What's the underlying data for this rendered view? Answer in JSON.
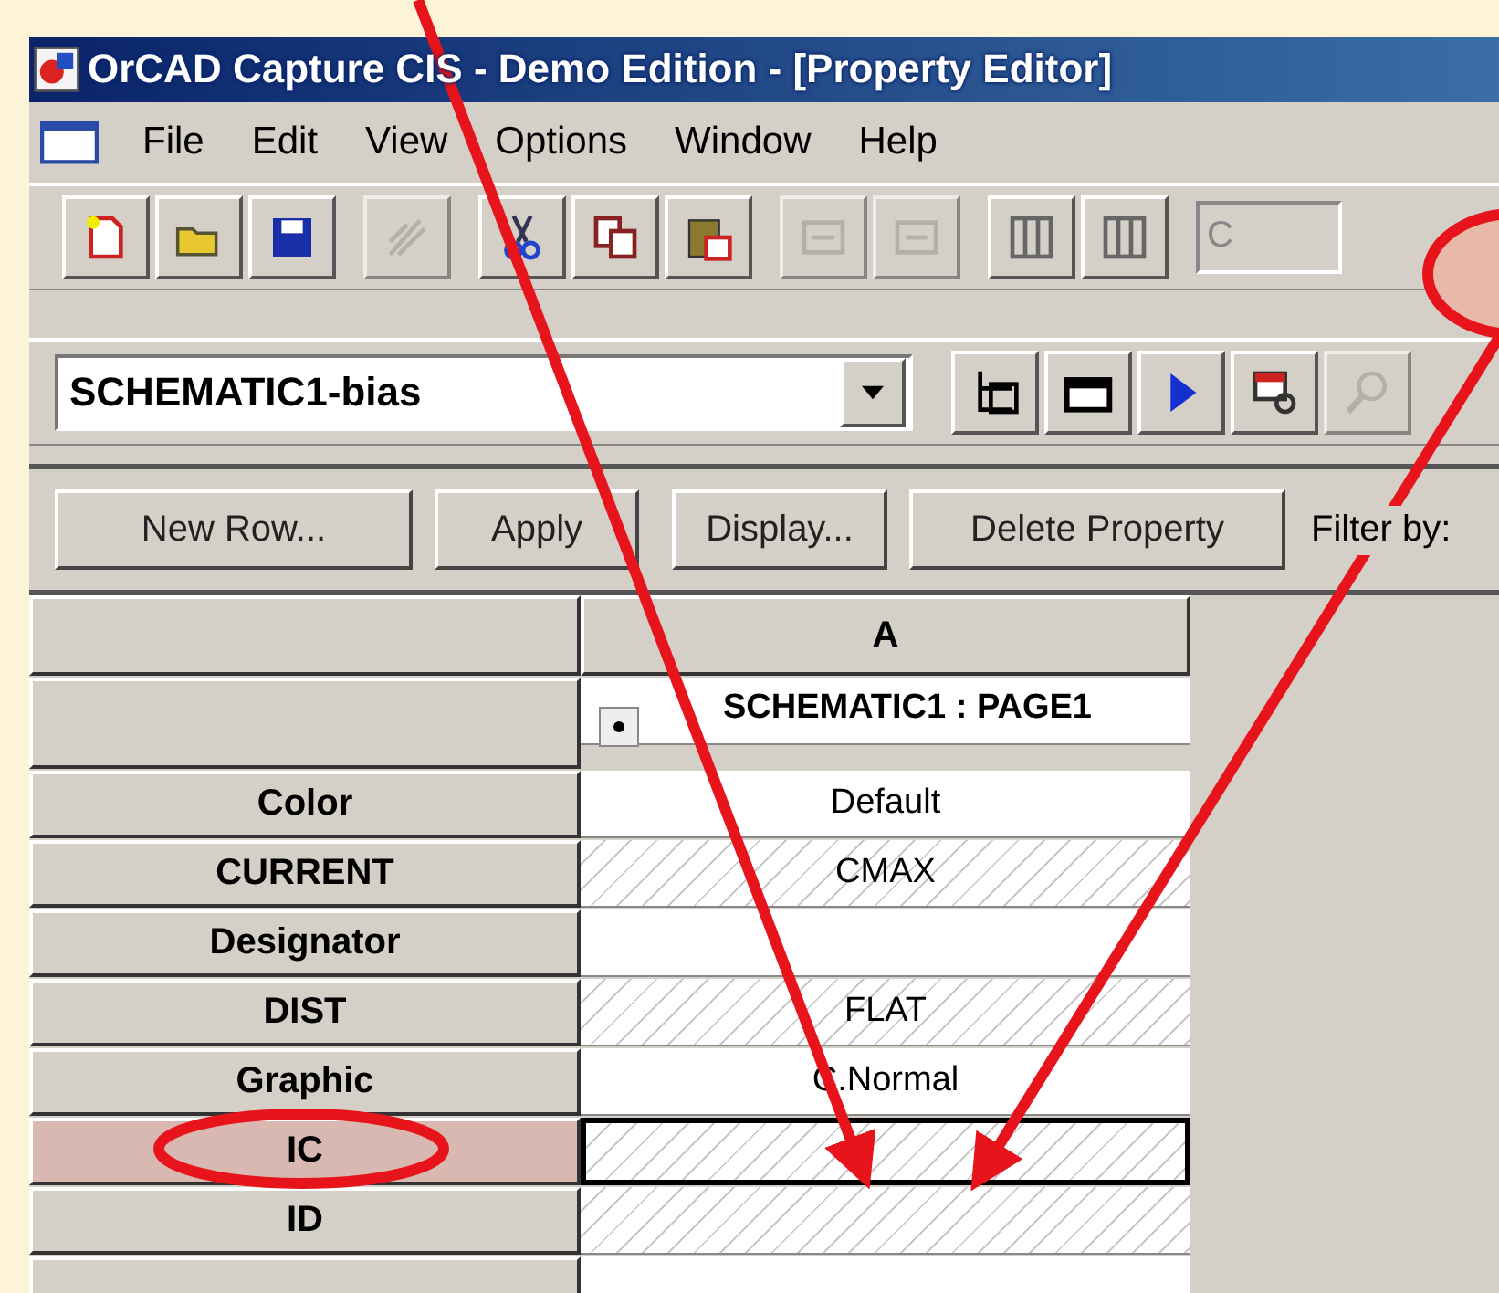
{
  "window": {
    "title": "OrCAD Capture CIS - Demo Edition - [Property Editor]"
  },
  "menu": [
    "File",
    "Edit",
    "View",
    "Options",
    "Window",
    "Help"
  ],
  "toolbar": {
    "buttons": [
      {
        "disabled": false
      },
      {
        "disabled": false
      },
      {
        "disabled": false
      },
      {
        "disabled": true
      },
      {
        "disabled": false
      },
      {
        "disabled": false
      },
      {
        "disabled": false
      },
      {
        "disabled": true
      },
      {
        "disabled": true
      },
      {
        "disabled": false
      },
      {
        "disabled": false
      }
    ],
    "field": "C"
  },
  "toolbar2": {
    "dropdown": "SCHEMATIC1-bias",
    "buttons": [
      {
        "disabled": false
      },
      {
        "disabled": false
      },
      {
        "disabled": false
      },
      {
        "disabled": false
      },
      {
        "disabled": true
      }
    ]
  },
  "actions": [
    "New Row...",
    "Apply",
    "Display...",
    "Delete Property"
  ],
  "filter_label": "Filter by:",
  "grid": {
    "column": "A",
    "group": "SCHEMATIC1 : PAGE1",
    "rows": [
      {
        "name": "Color",
        "value": "Default",
        "hatched": false,
        "selected": false
      },
      {
        "name": "CURRENT",
        "value": "CMAX",
        "hatched": true,
        "selected": false
      },
      {
        "name": "Designator",
        "value": "",
        "hatched": false,
        "selected": false
      },
      {
        "name": "DIST",
        "value": "FLAT",
        "hatched": true,
        "selected": false
      },
      {
        "name": "Graphic",
        "value": "C.Normal",
        "hatched": false,
        "selected": false
      },
      {
        "name": "IC",
        "value": "",
        "hatched": true,
        "selected": true
      },
      {
        "name": "ID",
        "value": "",
        "hatched": true,
        "selected": false
      },
      {
        "name": "",
        "value": "",
        "hatched": false,
        "selected": false
      }
    ]
  },
  "annotations": [
    {
      "kind": "arrow"
    },
    {
      "kind": "arrow"
    },
    {
      "kind": "ellipse"
    },
    {
      "kind": "ellipse"
    }
  ]
}
